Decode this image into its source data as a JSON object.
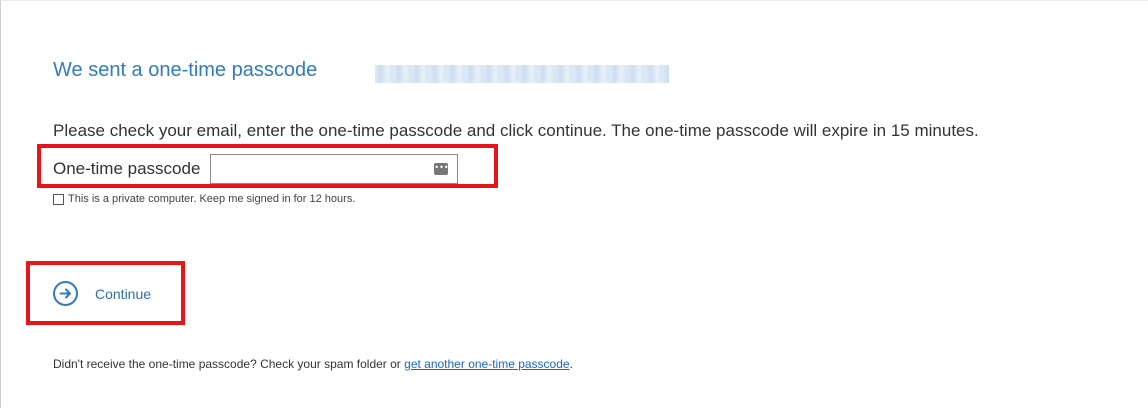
{
  "header": {
    "title": "We sent a one-time passcode"
  },
  "form": {
    "instructions": "Please check your email, enter the one-time passcode and click continue. The one-time passcode will expire in 15 minutes.",
    "otp_label": "One-time passcode",
    "otp_value": "",
    "keep_signed_in_label": "This is a private computer. Keep me signed in for 12 hours.",
    "keep_signed_in_checked": false
  },
  "actions": {
    "continue_label": "Continue"
  },
  "footer": {
    "text": "Didn't receive the one-time passcode? Check your spam folder or ",
    "link_text": "get another one-time passcode",
    "suffix": "."
  },
  "icons": {
    "continue": "arrow-right-circle-icon",
    "reveal": "password-manager-icon"
  },
  "colors": {
    "accent": "#2f7bbf",
    "link": "#1a66c2",
    "highlight": "#e8141a"
  }
}
